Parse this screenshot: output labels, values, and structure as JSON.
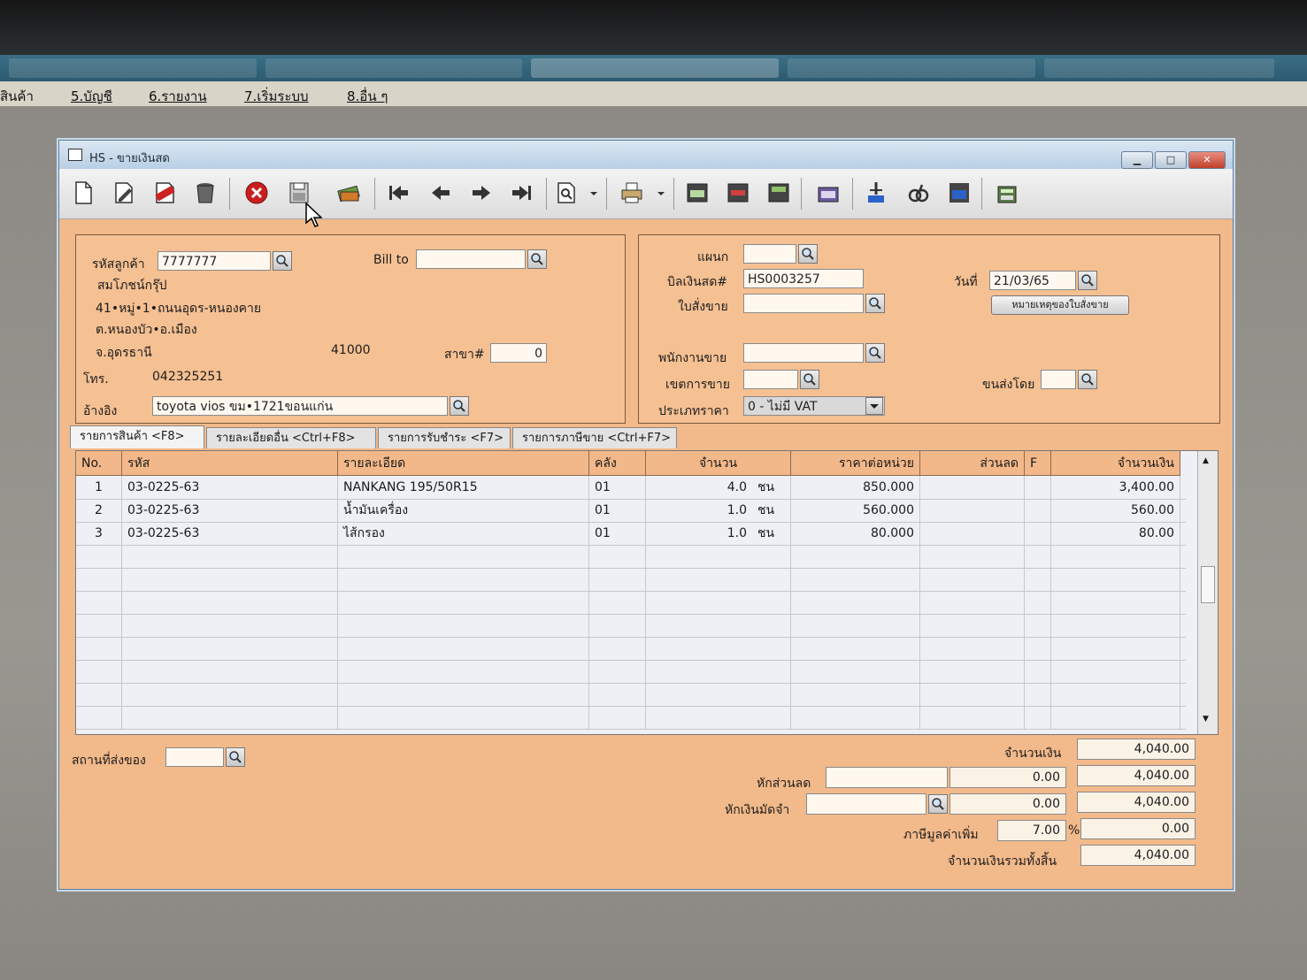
{
  "menu": [
    "สินค้า",
    "5.บัญชี",
    "6.รายงาน",
    "7.เริ่มระบบ",
    "8.อื่น ๆ"
  ],
  "window": {
    "title": "HS - ขายเงินสด"
  },
  "toolbar": [
    "new-doc-icon",
    "edit-icon",
    "void-icon",
    "trash-icon",
    "cancel-icon",
    "save-icon",
    "money-icon",
    "first-icon",
    "prev-icon",
    "next-icon",
    "last-icon",
    "find-icon",
    "print-icon",
    "post-icon",
    "report-icon",
    "sale-icon",
    "expense-icon",
    "approve-icon",
    "unlock-icon",
    "ok-icon",
    "calc-icon"
  ],
  "customer": {
    "code_label": "รหัสลูกค้า",
    "code": "7777777",
    "bill_to_label": "Bill to",
    "bill_to": "",
    "name": "สมโภชน์กรุ๊ป",
    "addr1": "41•หมู่•1•ถนนอุดร-หนองคาย",
    "addr2": "ต.หนองบัว•อ.เมือง",
    "province": "จ.อุดรธานี",
    "zip": "41000",
    "branch_label": "สาขา#",
    "branch": "0",
    "tel_label": "โทร.",
    "tel": "042325251",
    "ref_label": "อ้างอิง",
    "ref": "toyota vios ขม•1721ขอนแก่น"
  },
  "doc": {
    "dept_label": "แผนก",
    "dept": "",
    "bill_label": "บิลเงินสด#",
    "bill": "HS0003257",
    "date_label": "วันที่",
    "date": "21/03/65",
    "po_label": "ใบสั่งขาย",
    "po": "",
    "po_note_button": "หมายเหตุของใบสั่งขาย",
    "salesman_label": "พนักงานขาย",
    "salesman": "",
    "area_label": "เขตการขาย",
    "area": "",
    "ship_label": "ขนส่งโดย",
    "ship": "",
    "price_type_label": "ประเภทราคา",
    "price_type": "0 - ไม่มี VAT"
  },
  "tabs": [
    "รายการสินค้า <F8>",
    "รายละเอียดอื่น <Ctrl+F8>",
    "รายการรับชำระ <F7>",
    "รายการภาษีขาย <Ctrl+F7>"
  ],
  "grid": {
    "headers": [
      "No.",
      "รหัส",
      "รายละเอียด",
      "คลัง",
      "จำนวน",
      "ราคาต่อหน่วย",
      "ส่วนลด",
      "F",
      "จำนวนเงิน"
    ],
    "rows": [
      {
        "no": "1",
        "code": "03-0225-63",
        "desc": "NANKANG 195/50R15",
        "wh": "01",
        "qty": "4.0",
        "unit": "ชน",
        "price": "850.000",
        "disc": "",
        "f": "",
        "amount": "3,400.00"
      },
      {
        "no": "2",
        "code": "03-0225-63",
        "desc": "น้ำมันเครื่อง",
        "wh": "01",
        "qty": "1.0",
        "unit": "ชน",
        "price": "560.000",
        "disc": "",
        "f": "",
        "amount": "560.00"
      },
      {
        "no": "3",
        "code": "03-0225-63",
        "desc": "ไส้กรอง",
        "wh": "01",
        "qty": "1.0",
        "unit": "ชน",
        "price": "80.000",
        "disc": "",
        "f": "",
        "amount": "80.00"
      }
    ]
  },
  "footer": {
    "ship_place_label": "สถานที่ส่งของ",
    "ship_place": "",
    "amount_label": "จำนวนเงิน",
    "amount": "4,040.00",
    "discount_label": "หักส่วนลด",
    "discount_text": "",
    "discount": "0.00",
    "after_discount": "4,040.00",
    "deposit_label": "หักเงินมัดจำ",
    "deposit_text": "",
    "deposit": "0.00",
    "after_deposit": "4,040.00",
    "vat_label": "ภาษีมูลค่าเพิ่ม",
    "vat_rate": "7.00",
    "vat_pct": "%",
    "vat": "0.00",
    "total_label": "จำนวนเงินรวมทั้งสิ้น",
    "total": "4,040.00"
  }
}
